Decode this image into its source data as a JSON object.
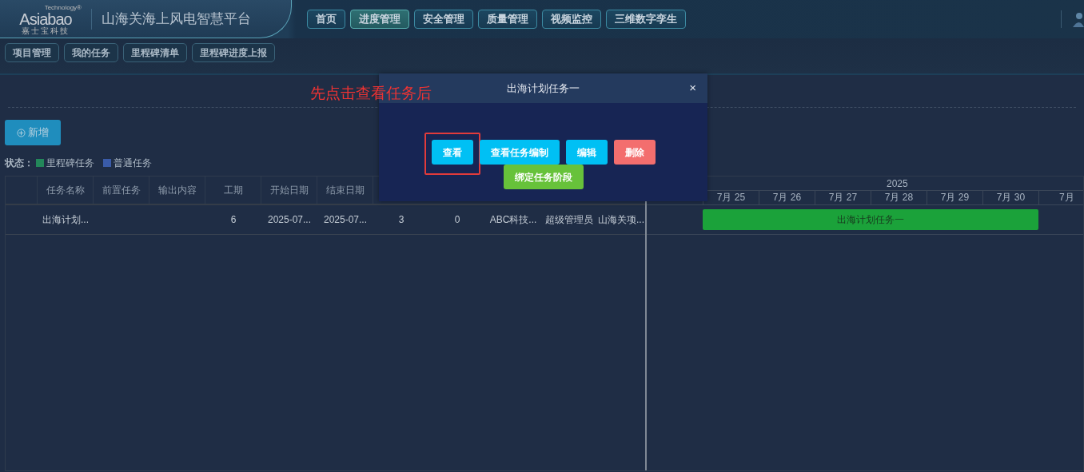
{
  "logo": {
    "tagline": "Technology®",
    "name": "Asiabao",
    "subtitle": "嘉士宝科技"
  },
  "app_title": "山海关海上风电智慧平台",
  "main_nav": [
    {
      "label": "首页",
      "selected": false
    },
    {
      "label": "进度管理",
      "selected": true
    },
    {
      "label": "安全管理",
      "selected": false
    },
    {
      "label": "质量管理",
      "selected": false
    },
    {
      "label": "视频监控",
      "selected": false
    },
    {
      "label": "三维数字孪生",
      "selected": false
    }
  ],
  "sub_nav": [
    "项目管理",
    "我的任务",
    "里程碑清单",
    "里程碑进度上报"
  ],
  "add_button": "新增",
  "legend": {
    "label": "状态：",
    "items": [
      {
        "label": "里程碑任务",
        "color": "#23875a"
      },
      {
        "label": "普通任务",
        "color": "#3a5ba8"
      }
    ]
  },
  "table": {
    "columns": [
      "任务名称",
      "前置任务",
      "输出内容",
      "工期",
      "开始日期",
      "结束日期"
    ],
    "rows": [
      {
        "name": "出海计划...",
        "duration": "6",
        "start": "2025-07...",
        "end": "2025-07...",
        "column_7": "3",
        "column_8": "0",
        "column_9": "ABC科技...",
        "column_10": "超级管理员",
        "column_11": "山海关项..."
      }
    ]
  },
  "gantt": {
    "year": "2025",
    "days": [
      "7月 25",
      "7月 26",
      "7月 27",
      "7月 28",
      "7月 29",
      "7月 30",
      "7月"
    ],
    "bars": [
      {
        "label": "出海计划任务一",
        "color": "#1ba23a"
      }
    ]
  },
  "annotation": "先点击查看任务后",
  "modal": {
    "title": "出海计划任务一",
    "close": "×",
    "buttons": [
      {
        "label": "查看",
        "kind": "info",
        "highlighted": true
      },
      {
        "label": "查看任务编制",
        "kind": "info",
        "highlighted": false
      },
      {
        "label": "编辑",
        "kind": "info",
        "highlighted": false
      },
      {
        "label": "删除",
        "kind": "danger",
        "highlighted": false
      },
      {
        "label": "绑定任务阶段",
        "kind": "success",
        "highlighted": false
      }
    ]
  }
}
